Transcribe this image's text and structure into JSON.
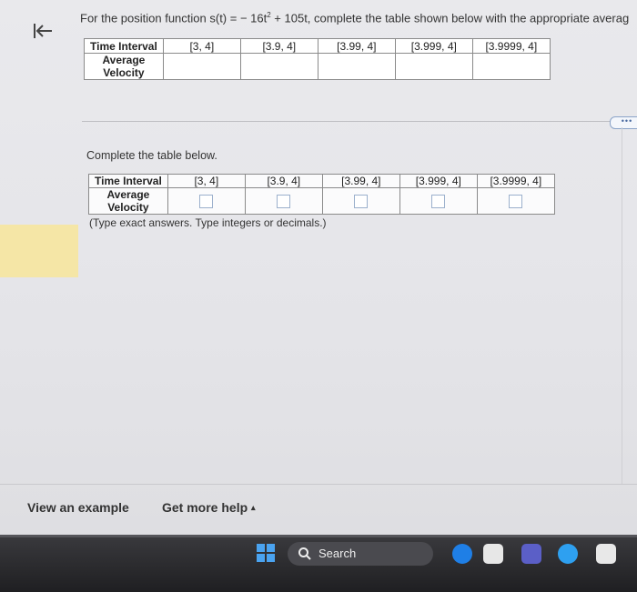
{
  "question": {
    "prefix": "For the position function s(t) = − 16t",
    "exponent": "2",
    "suffix": " + 105t, complete the table shown below with the appropriate averag"
  },
  "table_header": "Time Interval",
  "row_label_line1": "Average",
  "row_label_line2": "Velocity",
  "intervals": [
    "[3, 4]",
    "[3.9, 4]",
    "[3.99, 4]",
    "[3.999, 4]",
    "[3.9999, 4]"
  ],
  "instruction": "Complete the table below.",
  "answer_note": "(Type exact answers. Type integers or decimals.)",
  "more_label": "•••",
  "footer": {
    "view_example": "View an example",
    "get_help": "Get more help",
    "get_help_caret": "▴"
  },
  "taskbar": {
    "search_label": "Search",
    "colors": {
      "windows": "#4aa3f0",
      "edge": "#1f7fe6",
      "copilot": "#2ea0f0"
    }
  }
}
